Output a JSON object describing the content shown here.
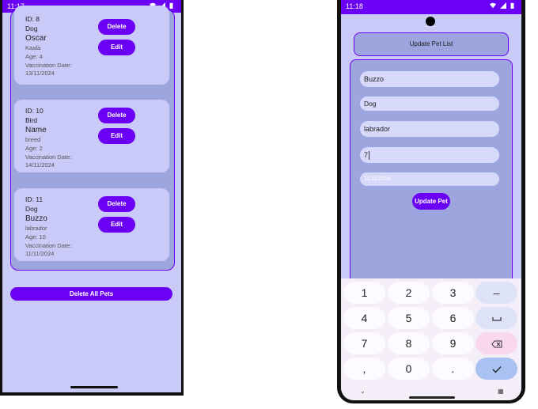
{
  "left_phone": {
    "status_time": "11:17",
    "pets": [
      {
        "id": "ID: 8",
        "species": "Dog",
        "name": "Oscar",
        "breed": "Kaala",
        "age": "Age: 4",
        "vacc_label": "Vaccination Date:",
        "vacc_date": "13/11/2024"
      },
      {
        "id": "ID: 10",
        "species": "Bird",
        "name": "Name",
        "breed": "breed",
        "age": "Age: 2",
        "vacc_label": "Vaccination Date:",
        "vacc_date": "14/11/2024"
      },
      {
        "id": "ID: 11",
        "species": "Dog",
        "name": "Buzzo",
        "breed": "labrador",
        "age": "Age: 10",
        "vacc_label": "Vaccination Date:",
        "vacc_date": "11/11/2024"
      }
    ],
    "delete_label": "Delete",
    "edit_label": "Edit",
    "delete_all_label": "Delete All Pets"
  },
  "right_phone": {
    "status_time": "11:18",
    "header_title": "Update Pet List",
    "fields": {
      "name": "Buzzo",
      "species": "Dog",
      "breed": "labrador",
      "age": "7",
      "date": "11/11/2024"
    },
    "update_button": "Update Pet",
    "keyboard": {
      "row1": [
        "1",
        "2",
        "3",
        "–"
      ],
      "row2": [
        "4",
        "5",
        "6",
        "⎵"
      ],
      "row3": [
        "7",
        "8",
        "9",
        "⌫"
      ],
      "row4": [
        ",",
        "0",
        ".",
        "✓"
      ]
    }
  },
  "colors": {
    "accent": "#6a00f4",
    "surface": "#c9caf7",
    "card_container": "#9da5df"
  }
}
